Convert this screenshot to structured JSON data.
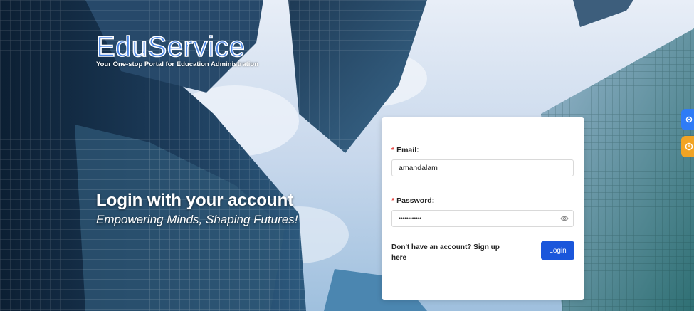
{
  "brand": {
    "title": "EduService",
    "tagline": "Your One-stop Portal for Education Administration"
  },
  "hero": {
    "title": "Login with your account",
    "subtitle": "Empowering Minds, Shaping Futures!"
  },
  "login_form": {
    "email": {
      "label": "Email:",
      "required_mark": "*",
      "value": "amandalam"
    },
    "password": {
      "label": "Password:",
      "required_mark": "*",
      "value": "••••••••••••"
    },
    "signup_text": "Don't have an account? Sign up here",
    "login_button": "Login"
  },
  "side_tabs": [
    {
      "icon": "gear-icon",
      "color": "#2f7cf6"
    },
    {
      "icon": "clock-icon",
      "color": "#f2a424"
    }
  ],
  "colors": {
    "primary_button": "#1a56db",
    "brand_blue": "#4b87e8",
    "required_red": "#e53935"
  }
}
